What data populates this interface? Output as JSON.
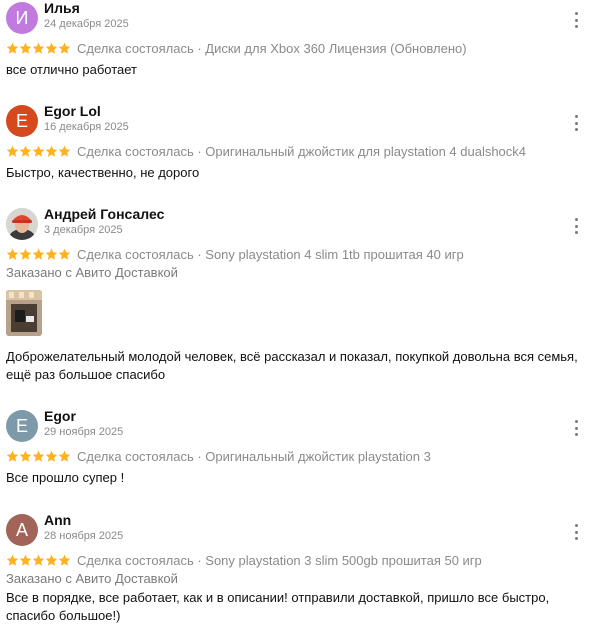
{
  "reviews": [
    {
      "name": "Илья",
      "initial": "И",
      "avatar_color": "#c17be0",
      "date": "24 декабря 2025",
      "stars": 5,
      "meta": "Сделка состоялась · Диски для Xbox 360 Лицензия (Обновлено)",
      "text": "все отлично работает"
    },
    {
      "name": "Egor Lol",
      "initial": "E",
      "avatar_color": "#d44a1e",
      "date": "16 декабря 2025",
      "stars": 5,
      "meta": "Сделка состоялась · Оригинальный джойстик для playstation 4 dualshock4",
      "text": "Быстро, качественно, не дорого"
    },
    {
      "name": "Андрей Гонсалес",
      "date": "3 декабря 2025",
      "stars": 5,
      "meta": "Сделка состоялась · Sony playstation 4 slim 1tb прошитая 40 игр",
      "delivery_note": "Заказано с Авито Доставкой",
      "text": "Доброжелательный молодой человек, всё рассказал и показал, покупкой довольна вся семья, ещё раз большое спасибо"
    },
    {
      "name": "Egor",
      "initial": "E",
      "avatar_color": "#7e9aaa",
      "date": "29 ноября 2025",
      "stars": 5,
      "meta": "Сделка состоялась · Оригинальный джойстик playstation 3",
      "text": "Все прошло супер !"
    },
    {
      "name": "Ann",
      "initial": "A",
      "avatar_color": "#a26458",
      "date": "28 ноября 2025",
      "stars": 5,
      "meta": "Сделка состоялась · Sony playstation 3 slim 500gb прошитая 50 игр",
      "delivery_note": "Заказано с Авито Доставкой",
      "text": "Все в порядке, все работает, как и в описании! отправили доставкой, пришло все быстро, спасибо большое!)"
    }
  ],
  "star_color": "#ffb21e"
}
